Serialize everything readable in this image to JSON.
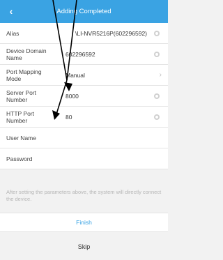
{
  "header": {
    "back_icon": "chevron-left-icon",
    "title": "Adding Completed"
  },
  "fields": {
    "alias": {
      "label": "Alias",
      "value": "\\LI-NVR5216P(602296592)"
    },
    "device_domain_name": {
      "label": "Device Domain Name",
      "value": "602296592"
    },
    "port_mapping_mode": {
      "label": "Port Mapping Mode",
      "value": "Manual"
    },
    "server_port": {
      "label": "Server Port Number",
      "value": "8000"
    },
    "http_port": {
      "label": "HTTP Port Number",
      "value": "80"
    },
    "user_name": {
      "label": "User Name",
      "value": ""
    },
    "password": {
      "label": "Password",
      "value": ""
    }
  },
  "hint": "After setting the parameters above, the system will directly connect the device.",
  "buttons": {
    "finish": "Finish",
    "skip": "Skip"
  },
  "colors": {
    "accent": "#3aa3e3",
    "annotation": "#000000"
  }
}
